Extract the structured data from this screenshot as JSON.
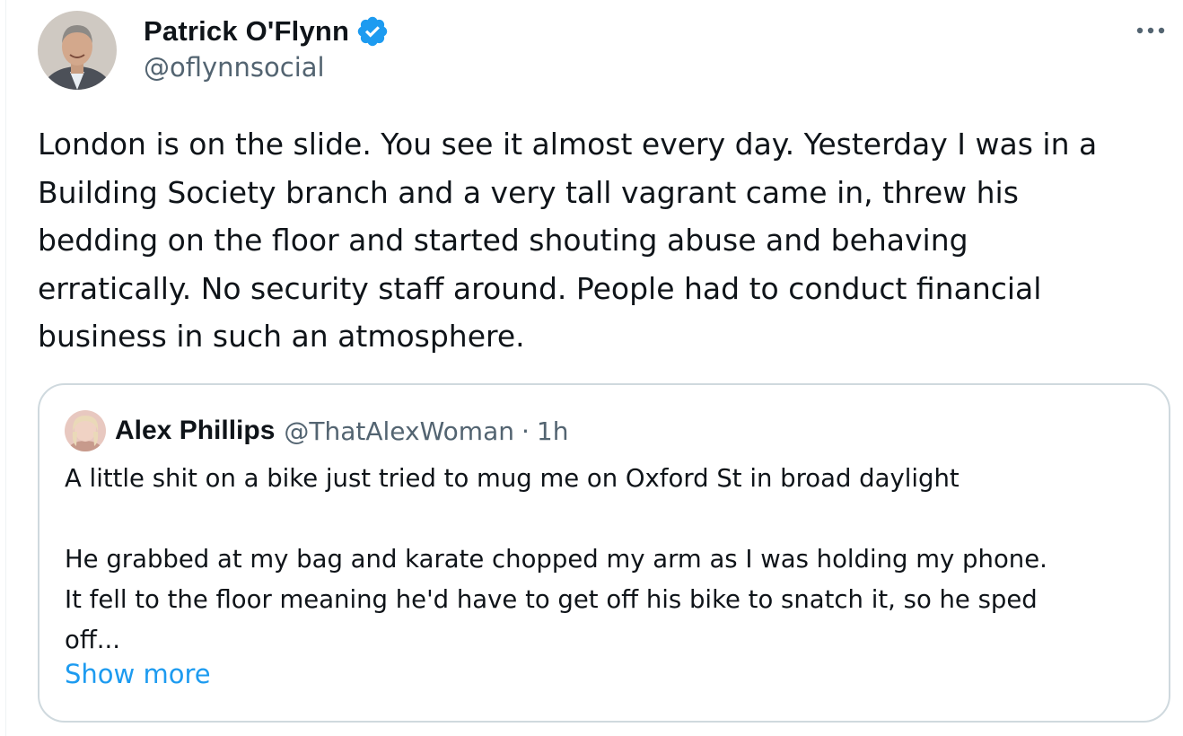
{
  "tweet": {
    "author": {
      "name": "Patrick O'Flynn",
      "handle": "@oflynnsocial",
      "verified": true,
      "avatar_icon": "person-photo-avatar"
    },
    "more_icon": "more-horizontal-icon",
    "text": "London is on the slide. You see it almost every day. Yesterday I was in a\nBuilding Society branch and a very tall vagrant came in, threw his\nbedding on the floor and started shouting abuse and behaving\nerratically. No security staff around. People had to conduct financial\nbusiness in such an atmosphere."
  },
  "quoted_tweet": {
    "author": {
      "name": "Alex Phillips",
      "handle": "@ThatAlexWoman",
      "time": "1h",
      "avatar_icon": "person-photo-avatar"
    },
    "separator": "·",
    "text": "A little shit on a bike just tried to mug me on Oxford St in broad daylight\n\nHe grabbed at my bag and karate chopped my arm as I was holding  my phone.\nIt fell to the floor meaning he'd have to get off his bike to snatch it, so he sped\noff...",
    "show_more_label": "Show more"
  },
  "colors": {
    "text_primary": "#0f1419",
    "text_secondary": "#536471",
    "accent": "#1d9bf0",
    "border": "#cfd9de"
  }
}
